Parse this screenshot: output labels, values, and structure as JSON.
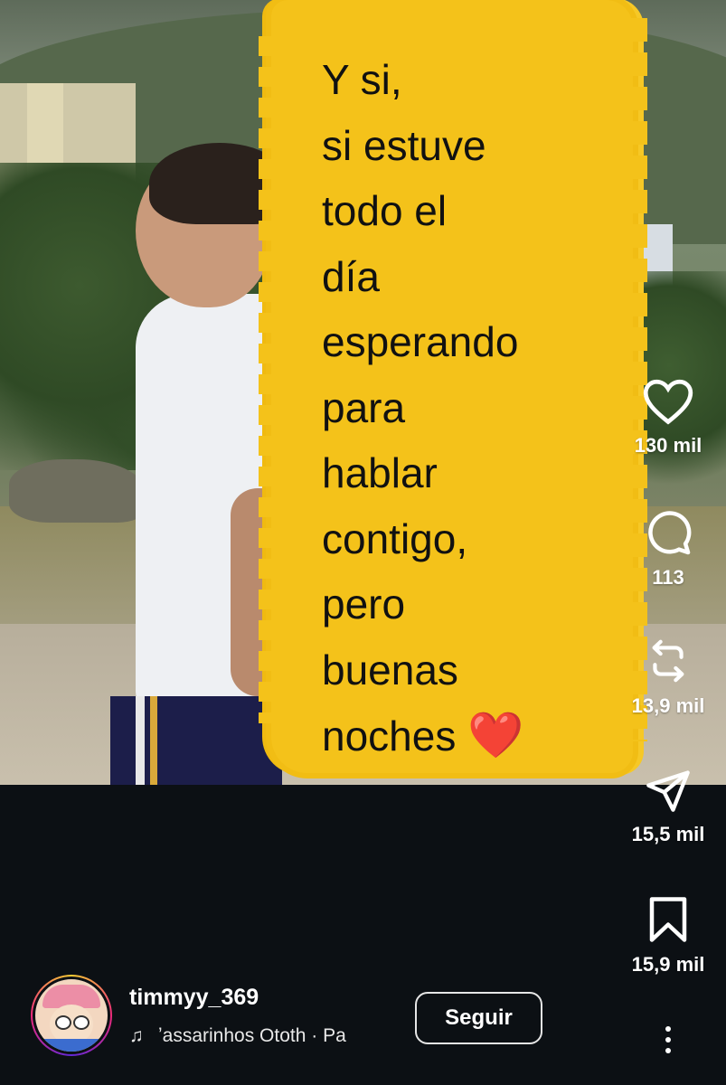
{
  "post": {
    "caption_lines": [
      "Y si,",
      "si estuve",
      "todo el",
      "día",
      "esperando",
      "para",
      "hablar",
      "contigo,",
      "pero",
      "buenas",
      "noches"
    ],
    "caption_emoji": "❤️"
  },
  "actions": {
    "like_count": "130 mil",
    "comment_count": "113",
    "repost_count": "13,9 mil",
    "share_count": "15,5 mil",
    "save_count": "15,9 mil",
    "icons": [
      "heart-icon",
      "comment-icon",
      "repost-icon",
      "send-icon",
      "bookmark-icon"
    ]
  },
  "author": {
    "username": "timmyy_369",
    "follow_label": "Seguir",
    "music_text": "ʼassarinhos    Ototh · Pa"
  },
  "colors": {
    "background": "#0c1014",
    "brush_yellow": "#f4c21a"
  }
}
